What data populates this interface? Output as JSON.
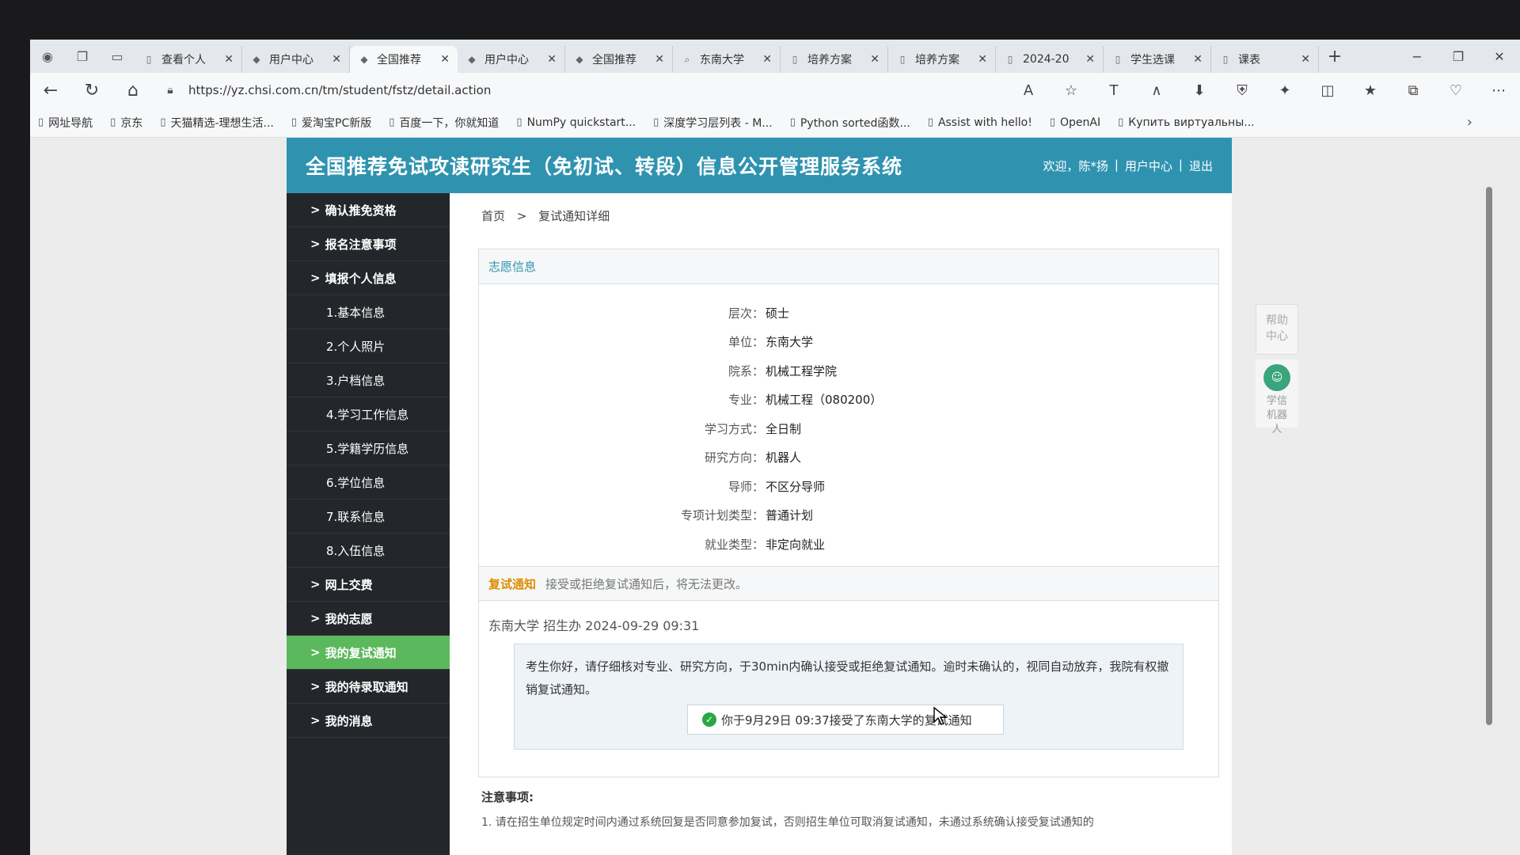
{
  "browser": {
    "tabs": [
      {
        "title": "查看个人",
        "icon": "file-icon"
      },
      {
        "title": "用户中心",
        "icon": "site-icon"
      },
      {
        "title": "全国推荐",
        "icon": "site-icon"
      },
      {
        "title": "用户中心",
        "icon": "site-icon"
      },
      {
        "title": "全国推荐",
        "icon": "site-icon"
      },
      {
        "title": "东南大学",
        "icon": "search-icon"
      },
      {
        "title": "培养方案",
        "icon": "file-icon"
      },
      {
        "title": "培养方案",
        "icon": "file-icon"
      },
      {
        "title": "2024-20",
        "icon": "file-icon"
      },
      {
        "title": "学生选课",
        "icon": "file-icon"
      },
      {
        "title": "课表",
        "icon": "file-icon"
      }
    ],
    "url": "https://yz.chsi.com.cn/tm/student/fstz/detail.action",
    "bookmarks": [
      "网址导航",
      "京东",
      "天猫精选-理想生活...",
      "爱淘宝PC新版",
      "百度一下，你就知道",
      "NumPy quickstart...",
      "深度学习层列表 - M...",
      "Python sorted函数...",
      "Assist with hello!",
      "OpenAI",
      "Купить виртуальны..."
    ]
  },
  "header": {
    "title": "全国推荐免试攻读研究生（免初试、转段）信息公开管理服务系统",
    "welcome": "欢迎，陈*扬",
    "user_center": "用户中心",
    "logout": "退出",
    "divider": "|"
  },
  "sidebar": {
    "items": [
      {
        "label": "确认推免资格",
        "level": "top"
      },
      {
        "label": "报名注意事项",
        "level": "top"
      },
      {
        "label": "填报个人信息",
        "level": "top"
      },
      {
        "label": "1.基本信息",
        "level": "sub"
      },
      {
        "label": "2.个人照片",
        "level": "sub"
      },
      {
        "label": "3.户档信息",
        "level": "sub"
      },
      {
        "label": "4.学习工作信息",
        "level": "sub"
      },
      {
        "label": "5.学籍学历信息",
        "level": "sub"
      },
      {
        "label": "6.学位信息",
        "level": "sub"
      },
      {
        "label": "7.联系信息",
        "level": "sub"
      },
      {
        "label": "8.入伍信息",
        "level": "sub"
      },
      {
        "label": "网上交费",
        "level": "top"
      },
      {
        "label": "我的志愿",
        "level": "top"
      },
      {
        "label": "我的复试通知",
        "level": "top",
        "active": true
      },
      {
        "label": "我的待录取通知",
        "level": "top"
      },
      {
        "label": "我的消息",
        "level": "top"
      }
    ]
  },
  "breadcrumb": {
    "home": "首页",
    "current": "复试通知详细",
    "sep": ">"
  },
  "volunteer": {
    "heading": "志愿信息",
    "rows": [
      {
        "label": "层次：",
        "value": "硕士"
      },
      {
        "label": "单位：",
        "value": "东南大学"
      },
      {
        "label": "院系：",
        "value": "机械工程学院"
      },
      {
        "label": "专业：",
        "value": "机械工程（080200）"
      },
      {
        "label": "学习方式：",
        "value": "全日制"
      },
      {
        "label": "研究方向：",
        "value": "机器人"
      },
      {
        "label": "导师：",
        "value": "不区分导师"
      },
      {
        "label": "专项计划类型：",
        "value": "普通计划"
      },
      {
        "label": "就业类型：",
        "value": "非定向就业"
      }
    ]
  },
  "notice": {
    "title": "复试通知",
    "desc": "接受或拒绝复试通知后，将无法更改。",
    "meta": "东南大学 招生办 2024-09-29 09:31",
    "text": "考生你好，请仔细核对专业、研究方向，于30min内确认接受或拒绝复试通知。逾时未确认的，视同自动放弃，我院有权撤销复试通知。",
    "accepted": "你于9月29日 09:37接受了东南大学的复试通知"
  },
  "attention": {
    "title": "注意事项:",
    "item1": "1. 请在招生单位规定时间内通过系统回复是否同意参加复试，否则招生单位可取消复试通知，未通过系统确认接受复试通知的"
  },
  "float": {
    "help": "帮助中心",
    "bot": "学信机器人"
  }
}
